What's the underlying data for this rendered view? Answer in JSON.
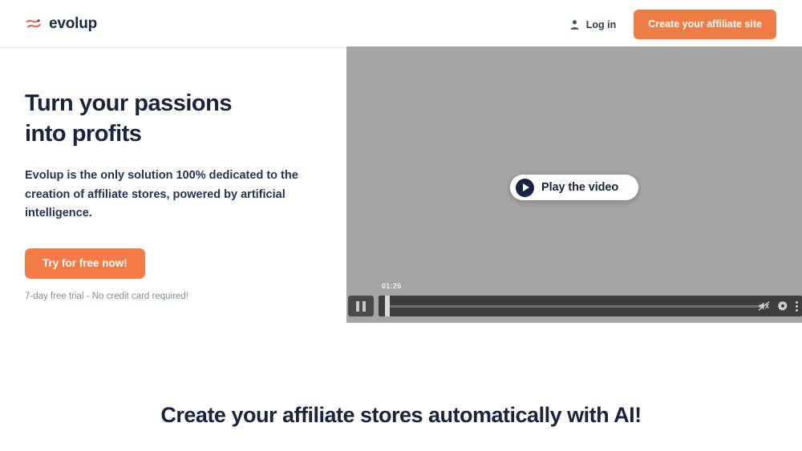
{
  "header": {
    "brand_name": "evolup",
    "brand_mark_icon": "evolup-swoosh-logo-icon",
    "login_label": "Log in",
    "login_icon": "user-person-icon",
    "cta_label": "Create your affiliate site"
  },
  "hero": {
    "title": "Turn your passions into profits",
    "subtitle": "Evolup is the only solution 100% dedicated to the creation of affiliate stores, powered by artificial intelligence.",
    "cta_label": "Try for free now!",
    "fineprint": "7-day free trial - No credit card required!"
  },
  "video": {
    "play_label": "Play the video",
    "play_icon": "play-triangle-icon",
    "pause_icon": "pause-icon",
    "timestamp": "01:26",
    "mute_icon": "speaker-muted-icon",
    "settings_icon": "gear-settings-icon",
    "more_icon": "more-vertical-dots-icon"
  },
  "section": {
    "heading": "Create your affiliate stores automatically with AI!"
  },
  "colors": {
    "accent_orange": "#f07c45",
    "navy": "#16243d",
    "video_gray": "#a4a4a4",
    "control_dark": "#3d3d3d",
    "fineprint_gray": "#7f8c9b"
  }
}
